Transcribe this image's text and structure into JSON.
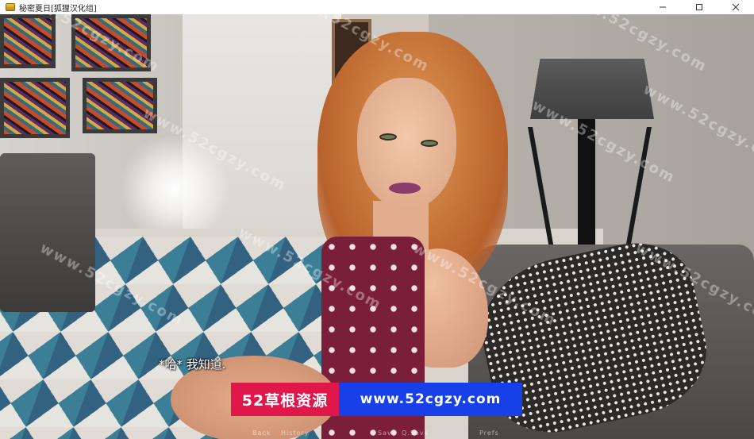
{
  "window": {
    "title": "秘密夏日[狐狸汉化组]",
    "controls": {
      "minimize": "—",
      "maximize": "☐",
      "close": "✕"
    }
  },
  "game": {
    "dialogue": "*哈* 我知道.",
    "watermark": "www.52cgzy.com",
    "quick_menu": [
      "Back",
      "History",
      "Save",
      "Q.Save",
      "Prefs"
    ],
    "banner": {
      "left_text": "52草根资源",
      "right_text": "www.52cgzy.com",
      "left_color": "#e0174a",
      "right_color": "#1840e8"
    }
  }
}
